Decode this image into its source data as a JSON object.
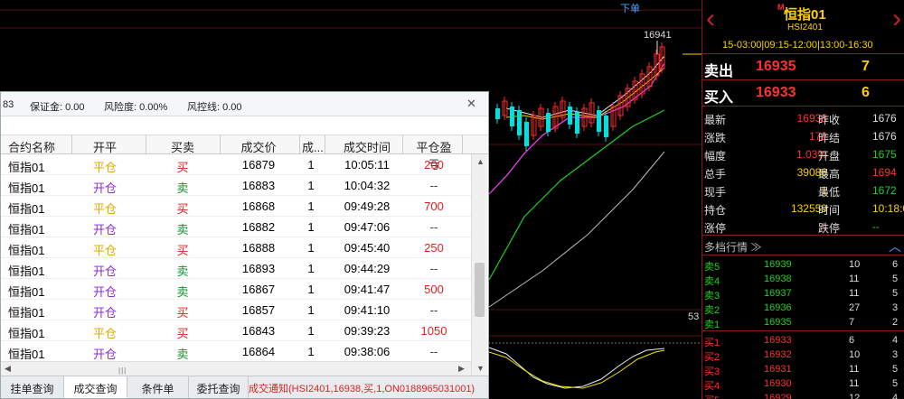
{
  "chart": {
    "xiadan_label": "下单",
    "peak_label": "16941",
    "right_value_label": "53",
    "colors": {
      "up": "#ff2a2a",
      "down": "#00e0e0",
      "ma_white": "#eeeeee",
      "ma_yellow": "#f0e000",
      "ma_magenta": "#ff40ff",
      "ma_green": "#20d020"
    }
  },
  "quote": {
    "marker": "M",
    "title": "恒指01",
    "code": "HSI2401",
    "sessions": "15-03:00|09:15-12:00|13:00-16:30",
    "ask": {
      "label": "卖出",
      "price": "16935",
      "qty": "7"
    },
    "bid": {
      "label": "买入",
      "price": "16933",
      "qty": "6"
    },
    "stats": [
      {
        "k1": "最新",
        "v1": "16933",
        "c1": "#ff3030",
        "k2": "昨收",
        "v2": "1676",
        "c2": "#dddddd"
      },
      {
        "k1": "涨跌",
        "v1": "172",
        "c1": "#ff3030",
        "k2": "昨结",
        "v2": "1676",
        "c2": "#dddddd"
      },
      {
        "k1": "幅度",
        "v1": "1.03%",
        "c1": "#ff3030",
        "k2": "开盘",
        "v2": "1675",
        "c2": "#20d020"
      },
      {
        "k1": "总手",
        "v1": "39086",
        "c1": "#ffd000",
        "k2": "最高",
        "v2": "1694",
        "c2": "#ff3030"
      },
      {
        "k1": "现手",
        "v1": "1",
        "c1": "#ffd000",
        "k2": "最低",
        "v2": "1672",
        "c2": "#20d020"
      },
      {
        "k1": "持仓",
        "v1": "132559",
        "c1": "#ffd000",
        "k2": "时间",
        "v2": "10:18:0",
        "c2": "#ffd000"
      },
      {
        "k1": "涨停",
        "v1": "--",
        "c1": "#ff3030",
        "k2": "跌停",
        "v2": "--",
        "c2": "#20d020"
      }
    ],
    "multi_label": "多档行情 ≫",
    "asks": [
      {
        "level": "卖5",
        "price": "16939",
        "q1": "10",
        "q2": "6"
      },
      {
        "level": "卖4",
        "price": "16938",
        "q1": "11",
        "q2": "5"
      },
      {
        "level": "卖3",
        "price": "16937",
        "q1": "11",
        "q2": "5"
      },
      {
        "level": "卖2",
        "price": "16936",
        "q1": "27",
        "q2": "3"
      },
      {
        "level": "卖1",
        "price": "16935",
        "q1": "7",
        "q2": "2"
      }
    ],
    "bids": [
      {
        "level": "买1",
        "price": "16933",
        "q1": "6",
        "q2": "4"
      },
      {
        "level": "买2",
        "price": "16932",
        "q1": "10",
        "q2": "3"
      },
      {
        "level": "买3",
        "price": "16931",
        "q1": "11",
        "q2": "5"
      },
      {
        "level": "买4",
        "price": "16930",
        "q1": "11",
        "q2": "5"
      },
      {
        "level": "买5",
        "price": "16929",
        "q1": "12",
        "q2": "4"
      }
    ]
  },
  "window": {
    "topbar": {
      "first": "83",
      "margin": "保证金: 0.00",
      "risk": "风险度: 0.00%",
      "control": "风控线: 0.00"
    },
    "columns": [
      "合约名称",
      "开平",
      "买卖",
      "成交价",
      "成...",
      "成交时间",
      "平仓盈亏"
    ],
    "rows": [
      {
        "name": "恒指01",
        "kp": "平仓",
        "mm": "买",
        "px": "16879",
        "n": "1",
        "tm": "10:05:11",
        "pl": "200"
      },
      {
        "name": "恒指01",
        "kp": "开仓",
        "mm": "卖",
        "px": "16883",
        "n": "1",
        "tm": "10:04:32",
        "pl": "--"
      },
      {
        "name": "恒指01",
        "kp": "平仓",
        "mm": "买",
        "px": "16868",
        "n": "1",
        "tm": "09:49:28",
        "pl": "700"
      },
      {
        "name": "恒指01",
        "kp": "开仓",
        "mm": "卖",
        "px": "16882",
        "n": "1",
        "tm": "09:47:06",
        "pl": "--"
      },
      {
        "name": "恒指01",
        "kp": "平仓",
        "mm": "买",
        "px": "16888",
        "n": "1",
        "tm": "09:45:40",
        "pl": "250"
      },
      {
        "name": "恒指01",
        "kp": "开仓",
        "mm": "卖",
        "px": "16893",
        "n": "1",
        "tm": "09:44:29",
        "pl": "--"
      },
      {
        "name": "恒指01",
        "kp": "开仓",
        "mm": "卖",
        "px": "16867",
        "n": "1",
        "tm": "09:41:47",
        "pl": "500"
      },
      {
        "name": "恒指01",
        "kp": "开仓",
        "mm": "买",
        "px": "16857",
        "n": "1",
        "tm": "09:41:10",
        "pl": "--"
      },
      {
        "name": "恒指01",
        "kp": "平仓",
        "mm": "买",
        "px": "16843",
        "n": "1",
        "tm": "09:39:23",
        "pl": "1050"
      },
      {
        "name": "恒指01",
        "kp": "开仓",
        "mm": "卖",
        "px": "16864",
        "n": "1",
        "tm": "09:38:06",
        "pl": "--"
      }
    ],
    "tabs": [
      "挂单查询",
      "成交查询",
      "条件单",
      "委托查询"
    ],
    "active_tab": 1,
    "notice": "成交通知(HSI2401,16938,买,1,ON0188965031001)"
  }
}
